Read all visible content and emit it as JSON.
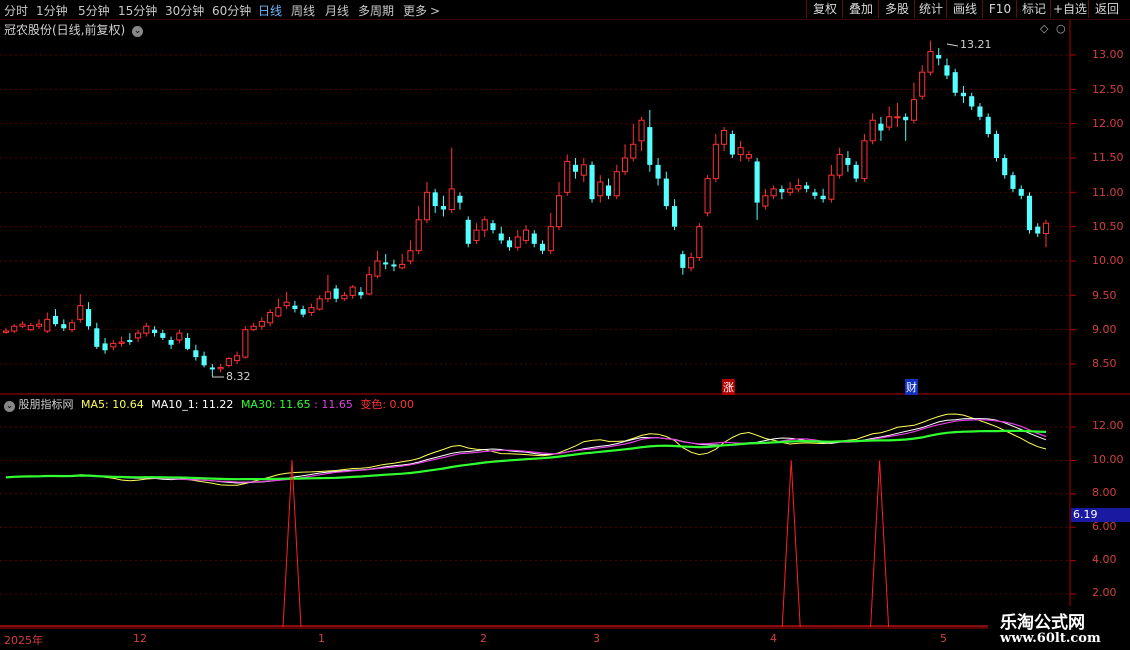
{
  "periods": [
    "分时",
    "1分钟",
    "5分钟",
    "15分钟",
    "30分钟",
    "60分钟",
    "日线",
    "周线",
    "月线",
    "多周期",
    "更多"
  ],
  "more_glyph": ">",
  "toolbar": [
    "复权",
    "叠加",
    "多股",
    "统计",
    "画线",
    "F10",
    "标记",
    "+自选",
    "返回"
  ],
  "stock_title": "冠农股份(日线,前复权)",
  "main_yaxis": [
    "13.00",
    "12.50",
    "12.00",
    "11.50",
    "11.00",
    "10.50",
    "10.00",
    "9.50",
    "9.00",
    "8.50"
  ],
  "high_label": "13.21",
  "low_label": "8.32",
  "markers": [
    "涨",
    "财"
  ],
  "indicator": {
    "name": "股朋指标网",
    "ma5": "MA5: 10.64",
    "ma10": "MA10_1: 11.22",
    "ma30": "MA30: 11.65",
    "extra": ": 11.65",
    "bianse": "变色: 0.00"
  },
  "sub_yaxis": [
    "12.00",
    "10.00",
    "8.00",
    "6.00",
    "4.00",
    "2.00"
  ],
  "current_value": "6.19",
  "time_axis": [
    "2025年",
    "12",
    "1",
    "2",
    "3",
    "4",
    "5"
  ],
  "watermark": {
    "title": "乐淘公式网",
    "url": "www.60lt.com"
  },
  "colors": {
    "up": "#ff3232",
    "down": "#54ffff",
    "ma5": "#ffff5a",
    "ma10": "#e040e0",
    "ma30": "#30ff30",
    "grid": "#5a0000"
  },
  "chart_data": {
    "type": "candlestick",
    "price_range": [
      8.0,
      13.5
    ],
    "candles": [
      [
        8.96,
        8.98,
        9.02,
        8.94
      ],
      [
        8.98,
        9.05,
        9.08,
        8.95
      ],
      [
        9.05,
        9.08,
        9.12,
        9.02
      ],
      [
        9.0,
        9.06,
        9.1,
        8.98
      ],
      [
        9.05,
        9.08,
        9.15,
        9.01
      ],
      [
        8.98,
        9.15,
        9.25,
        8.95
      ],
      [
        9.2,
        9.08,
        9.3,
        9.05
      ],
      [
        9.08,
        9.02,
        9.15,
        8.98
      ],
      [
        9.0,
        9.1,
        9.15,
        8.96
      ],
      [
        9.15,
        9.35,
        9.52,
        9.1
      ],
      [
        9.3,
        9.05,
        9.4,
        9.0
      ],
      [
        9.02,
        8.75,
        9.1,
        8.72
      ],
      [
        8.8,
        8.7,
        8.88,
        8.65
      ],
      [
        8.75,
        8.8,
        8.85,
        8.7
      ],
      [
        8.8,
        8.82,
        8.9,
        8.75
      ],
      [
        8.85,
        8.82,
        8.95,
        8.78
      ],
      [
        8.88,
        8.95,
        9.0,
        8.82
      ],
      [
        8.95,
        9.05,
        9.1,
        8.9
      ],
      [
        9.0,
        8.95,
        9.05,
        8.9
      ],
      [
        8.95,
        8.88,
        9.0,
        8.85
      ],
      [
        8.85,
        8.78,
        8.9,
        8.72
      ],
      [
        8.85,
        8.95,
        9.0,
        8.8
      ],
      [
        8.88,
        8.72,
        8.95,
        8.7
      ],
      [
        8.7,
        8.6,
        8.78,
        8.55
      ],
      [
        8.62,
        8.48,
        8.68,
        8.45
      ],
      [
        8.45,
        8.42,
        8.5,
        8.32
      ],
      [
        8.43,
        8.45,
        8.5,
        8.38
      ],
      [
        8.48,
        8.58,
        8.6,
        8.45
      ],
      [
        8.55,
        8.62,
        8.68,
        8.5
      ],
      [
        8.6,
        9.0,
        9.05,
        8.58
      ],
      [
        9.0,
        9.05,
        9.1,
        8.98
      ],
      [
        9.05,
        9.12,
        9.18,
        9.0
      ],
      [
        9.1,
        9.25,
        9.3,
        9.05
      ],
      [
        9.2,
        9.32,
        9.45,
        9.18
      ],
      [
        9.35,
        9.4,
        9.55,
        9.3
      ],
      [
        9.35,
        9.3,
        9.42,
        9.25
      ],
      [
        9.3,
        9.22,
        9.35,
        9.18
      ],
      [
        9.25,
        9.32,
        9.38,
        9.2
      ],
      [
        9.3,
        9.45,
        9.5,
        9.28
      ],
      [
        9.45,
        9.55,
        9.8,
        9.4
      ],
      [
        9.6,
        9.45,
        9.65,
        9.4
      ],
      [
        9.45,
        9.5,
        9.55,
        9.42
      ],
      [
        9.5,
        9.62,
        9.65,
        9.45
      ],
      [
        9.55,
        9.5,
        9.62,
        9.45
      ],
      [
        9.52,
        9.8,
        9.92,
        9.5
      ],
      [
        9.78,
        10.0,
        10.15,
        9.75
      ],
      [
        9.98,
        9.95,
        10.1,
        9.88
      ],
      [
        9.95,
        9.92,
        10.02,
        9.85
      ],
      [
        9.9,
        9.95,
        10.1,
        9.88
      ],
      [
        10.0,
        10.15,
        10.3,
        9.95
      ],
      [
        10.15,
        10.6,
        10.8,
        10.1
      ],
      [
        10.6,
        11.0,
        11.15,
        10.55
      ],
      [
        11.0,
        10.8,
        11.05,
        10.7
      ],
      [
        10.8,
        10.75,
        10.95,
        10.65
      ],
      [
        10.75,
        11.05,
        11.65,
        10.7
      ],
      [
        10.95,
        10.85,
        11.0,
        10.75
      ],
      [
        10.6,
        10.25,
        10.65,
        10.2
      ],
      [
        10.3,
        10.45,
        10.55,
        10.25
      ],
      [
        10.45,
        10.6,
        10.65,
        10.35
      ],
      [
        10.55,
        10.45,
        10.6,
        10.4
      ],
      [
        10.4,
        10.3,
        10.5,
        10.25
      ],
      [
        10.3,
        10.2,
        10.35,
        10.15
      ],
      [
        10.2,
        10.35,
        10.45,
        10.15
      ],
      [
        10.3,
        10.45,
        10.52,
        10.25
      ],
      [
        10.4,
        10.25,
        10.45,
        10.2
      ],
      [
        10.25,
        10.15,
        10.3,
        10.1
      ],
      [
        10.15,
        10.5,
        10.7,
        10.1
      ],
      [
        10.5,
        10.95,
        11.15,
        10.45
      ],
      [
        11.0,
        11.45,
        11.55,
        10.95
      ],
      [
        11.4,
        11.3,
        11.5,
        11.2
      ],
      [
        11.25,
        11.4,
        11.5,
        11.15
      ],
      [
        11.4,
        10.9,
        11.45,
        10.85
      ],
      [
        10.95,
        11.15,
        11.25,
        10.85
      ],
      [
        11.1,
        10.95,
        11.2,
        10.9
      ],
      [
        10.95,
        11.3,
        11.4,
        10.9
      ],
      [
        11.3,
        11.5,
        11.7,
        11.25
      ],
      [
        11.5,
        11.7,
        12.0,
        11.45
      ],
      [
        11.75,
        12.05,
        12.1,
        11.6
      ],
      [
        11.95,
        11.4,
        12.2,
        11.3
      ],
      [
        11.4,
        11.2,
        11.5,
        11.1
      ],
      [
        11.2,
        10.8,
        11.3,
        10.75
      ],
      [
        10.8,
        10.5,
        10.9,
        10.45
      ],
      [
        10.1,
        9.9,
        10.15,
        9.8
      ],
      [
        9.9,
        10.05,
        10.12,
        9.85
      ],
      [
        10.05,
        10.5,
        10.55,
        10.0
      ],
      [
        10.7,
        11.2,
        11.25,
        10.65
      ],
      [
        11.2,
        11.7,
        11.85,
        11.15
      ],
      [
        11.7,
        11.9,
        11.95,
        11.6
      ],
      [
        11.85,
        11.55,
        11.9,
        11.5
      ],
      [
        11.55,
        11.65,
        11.75,
        11.45
      ],
      [
        11.5,
        11.55,
        11.6,
        11.45
      ],
      [
        11.45,
        10.85,
        11.5,
        10.6
      ],
      [
        10.8,
        10.95,
        11.05,
        10.75
      ],
      [
        10.95,
        11.05,
        11.1,
        10.9
      ],
      [
        11.05,
        11.0,
        11.1,
        10.9
      ],
      [
        11.0,
        11.05,
        11.15,
        10.95
      ],
      [
        11.05,
        11.1,
        11.2,
        11.0
      ],
      [
        11.1,
        11.05,
        11.15,
        11.0
      ],
      [
        11.0,
        10.95,
        11.05,
        10.9
      ],
      [
        10.95,
        10.9,
        11.05,
        10.85
      ],
      [
        10.9,
        11.25,
        11.4,
        10.85
      ],
      [
        11.25,
        11.55,
        11.65,
        11.2
      ],
      [
        11.5,
        11.4,
        11.6,
        11.3
      ],
      [
        11.4,
        11.2,
        11.45,
        11.15
      ],
      [
        11.2,
        11.75,
        11.85,
        11.15
      ],
      [
        11.75,
        12.05,
        12.15,
        11.7
      ],
      [
        12.0,
        11.9,
        12.1,
        11.75
      ],
      [
        11.95,
        12.1,
        12.25,
        11.9
      ],
      [
        12.1,
        12.1,
        12.3,
        11.95
      ],
      [
        12.1,
        12.05,
        12.15,
        11.75
      ],
      [
        12.05,
        12.35,
        12.6,
        12.0
      ],
      [
        12.4,
        12.75,
        12.85,
        12.35
      ],
      [
        12.75,
        13.05,
        13.21,
        12.7
      ],
      [
        13.0,
        12.95,
        13.1,
        12.85
      ],
      [
        12.85,
        12.7,
        12.95,
        12.65
      ],
      [
        12.75,
        12.45,
        12.8,
        12.4
      ],
      [
        12.45,
        12.4,
        12.55,
        12.3
      ],
      [
        12.4,
        12.25,
        12.45,
        12.2
      ],
      [
        12.25,
        12.1,
        12.3,
        12.05
      ],
      [
        12.1,
        11.85,
        12.15,
        11.8
      ],
      [
        11.85,
        11.5,
        11.9,
        11.45
      ],
      [
        11.5,
        11.25,
        11.55,
        11.2
      ],
      [
        11.25,
        11.05,
        11.3,
        11.0
      ],
      [
        11.05,
        10.95,
        11.1,
        10.9
      ],
      [
        10.95,
        10.45,
        11.0,
        10.4
      ],
      [
        10.5,
        10.4,
        10.55,
        10.35
      ],
      [
        10.4,
        10.55,
        10.6,
        10.2
      ]
    ],
    "indicator_range": [
      1.0,
      13.5
    ],
    "spike_positions": [
      0.275,
      0.755,
      0.84
    ],
    "spike_value": 10.0
  }
}
